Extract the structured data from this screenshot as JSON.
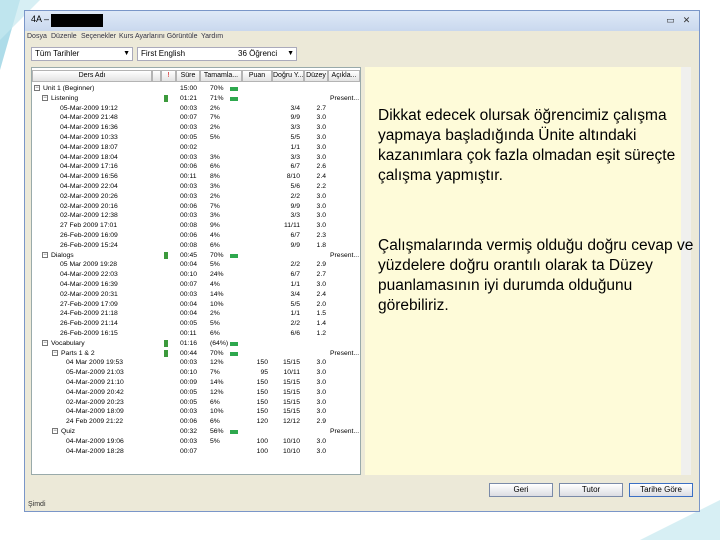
{
  "window": {
    "title": "4A –",
    "controls": [
      "▭",
      "✕"
    ]
  },
  "menu": [
    "Dosya",
    "Düzenle",
    "Seçenekler",
    "Kurs Ayarlarını Görüntüle",
    "Yardım"
  ],
  "filters": {
    "group": "Tüm Tarihler",
    "course": "First English",
    "count": "36 Öğrenci"
  },
  "columns": [
    "Ders Adı",
    "",
    "",
    "Süre",
    "Tamamla...",
    "Puan",
    "Doğru Y...",
    "Düzey",
    "Açıkla..."
  ],
  "rows": [
    {
      "lvl": 0,
      "toggle": "−",
      "name": "Unit 1 (Beginner)",
      "flag": false,
      "time": "15:00",
      "pct": "70%",
      "bar": true,
      "score": "",
      "correct": "",
      "level": "",
      "note": ""
    },
    {
      "lvl": 1,
      "toggle": "−",
      "name": "Listening",
      "flag": true,
      "time": "01:21",
      "pct": "71%",
      "bar": true,
      "score": "",
      "correct": "",
      "level": "",
      "note": "Present..."
    },
    {
      "lvl": 2,
      "name": "05-Mar-2009 19:12",
      "time": "00:03",
      "pct": "2%",
      "score": "",
      "correct": "3/4",
      "level": "2.7",
      "note": ""
    },
    {
      "lvl": 2,
      "name": "04-Mar-2009 21:48",
      "time": "00:07",
      "pct": "7%",
      "score": "",
      "correct": "9/9",
      "level": "3.0",
      "note": ""
    },
    {
      "lvl": 2,
      "name": "04-Mar-2009 16:36",
      "time": "00:03",
      "pct": "2%",
      "score": "",
      "correct": "3/3",
      "level": "3.0",
      "note": ""
    },
    {
      "lvl": 2,
      "name": "04-Mar-2009 10:33",
      "time": "00:05",
      "pct": "5%",
      "score": "",
      "correct": "5/5",
      "level": "3.0",
      "note": ""
    },
    {
      "lvl": 2,
      "name": "04-Mar-2009 18:07",
      "time": "00:02",
      "pct": "",
      "score": "",
      "correct": "1/1",
      "level": "3.0",
      "note": ""
    },
    {
      "lvl": 2,
      "name": "04-Mar-2009 18:04",
      "time": "00:03",
      "pct": "3%",
      "score": "",
      "correct": "3/3",
      "level": "3.0",
      "note": ""
    },
    {
      "lvl": 2,
      "name": "04-Mar-2009 17:16",
      "time": "00:06",
      "pct": "6%",
      "score": "",
      "correct": "6/7",
      "level": "2.6",
      "note": ""
    },
    {
      "lvl": 2,
      "name": "04-Mar-2009 16:56",
      "time": "00:11",
      "pct": "8%",
      "score": "",
      "correct": "8/10",
      "level": "2.4",
      "note": ""
    },
    {
      "lvl": 2,
      "name": "04-Mar-2009 22:04",
      "time": "00:03",
      "pct": "3%",
      "score": "",
      "correct": "5/6",
      "level": "2.2",
      "note": ""
    },
    {
      "lvl": 2,
      "name": "02-Mar-2009 20:26",
      "time": "00:03",
      "pct": "2%",
      "score": "",
      "correct": "2/2",
      "level": "3.0",
      "note": ""
    },
    {
      "lvl": 2,
      "name": "02-Mar-2009 20:16",
      "time": "00:06",
      "pct": "7%",
      "score": "",
      "correct": "9/9",
      "level": "3.0",
      "note": ""
    },
    {
      "lvl": 2,
      "name": "02-Mar-2009 12:38",
      "time": "00:03",
      "pct": "3%",
      "score": "",
      "correct": "3/3",
      "level": "3.0",
      "note": ""
    },
    {
      "lvl": 2,
      "name": "27 Feb 2009 17:01",
      "time": "00:08",
      "pct": "9%",
      "score": "",
      "correct": "11/11",
      "level": "3.0",
      "note": ""
    },
    {
      "lvl": 2,
      "name": "26-Feb-2009 16:09",
      "time": "00:06",
      "pct": "4%",
      "score": "",
      "correct": "6/7",
      "level": "2.3",
      "note": ""
    },
    {
      "lvl": 2,
      "name": "26-Feb-2009 15:24",
      "time": "00:08",
      "pct": "6%",
      "score": "",
      "correct": "9/9",
      "level": "1.8",
      "note": ""
    },
    {
      "lvl": 1,
      "toggle": "−",
      "name": "Dialogs",
      "flag": true,
      "time": "00:45",
      "pct": "70%",
      "bar": true,
      "score": "",
      "correct": "",
      "level": "",
      "note": "Present..."
    },
    {
      "lvl": 2,
      "name": "05 Mar 2009 19:28",
      "time": "00:04",
      "pct": "5%",
      "score": "",
      "correct": "2/2",
      "level": "2.9",
      "note": ""
    },
    {
      "lvl": 2,
      "name": "04-Mar-2009 22:03",
      "time": "00:10",
      "pct": "24%",
      "score": "",
      "correct": "6/7",
      "level": "2.7",
      "note": ""
    },
    {
      "lvl": 2,
      "name": "04-Mar-2009 16:39",
      "time": "00:07",
      "pct": "4%",
      "score": "",
      "correct": "1/1",
      "level": "3.0",
      "note": ""
    },
    {
      "lvl": 2,
      "name": "02-Mar-2009 20:31",
      "time": "00:03",
      "pct": "14%",
      "score": "",
      "correct": "3/4",
      "level": "2.4",
      "note": ""
    },
    {
      "lvl": 2,
      "name": "27-Feb-2009 17:09",
      "time": "00:04",
      "pct": "10%",
      "score": "",
      "correct": "5/5",
      "level": "2.0",
      "note": ""
    },
    {
      "lvl": 2,
      "name": "24-Feb-2009 21:18",
      "time": "00:04",
      "pct": "2%",
      "score": "",
      "correct": "1/1",
      "level": "1.5",
      "note": ""
    },
    {
      "lvl": 2,
      "name": "26-Feb-2009 21:14",
      "time": "00:05",
      "pct": "5%",
      "score": "",
      "correct": "2/2",
      "level": "1.4",
      "note": ""
    },
    {
      "lvl": 2,
      "name": "26-Feb-2009 16:15",
      "time": "00:11",
      "pct": "6%",
      "score": "",
      "correct": "6/6",
      "level": "1.2",
      "note": ""
    },
    {
      "lvl": 1,
      "toggle": "−",
      "name": "Vocabulary",
      "flag": true,
      "time": "01:16",
      "pct": "(64%)",
      "bar": true,
      "score": "",
      "correct": "",
      "level": "",
      "note": ""
    },
    {
      "lvl": 2,
      "toggle": "−",
      "name": "Parts 1 & 2",
      "flag": true,
      "time": "00:44",
      "pct": "70%",
      "bar": true,
      "score": "",
      "correct": "",
      "level": "",
      "note": "Present..."
    },
    {
      "lvl": 3,
      "name": "04 Mar 2009 19:53",
      "time": "00:03",
      "pct": "12%",
      "score": "150",
      "correct": "15/15",
      "level": "3.0",
      "note": ""
    },
    {
      "lvl": 3,
      "name": "05-Mar-2009 21:03",
      "time": "00:10",
      "pct": "7%",
      "score": "95",
      "correct": "10/11",
      "level": "3.0",
      "note": ""
    },
    {
      "lvl": 3,
      "name": "04-Mar-2009 21:10",
      "time": "00:09",
      "pct": "14%",
      "score": "150",
      "correct": "15/15",
      "level": "3.0",
      "note": ""
    },
    {
      "lvl": 3,
      "name": "04-Mar-2009 20:42",
      "time": "00:05",
      "pct": "12%",
      "score": "150",
      "correct": "15/15",
      "level": "3.0",
      "note": ""
    },
    {
      "lvl": 3,
      "name": "02-Mar-2009 20:23",
      "time": "00:05",
      "pct": "6%",
      "score": "150",
      "correct": "15/15",
      "level": "3.0",
      "note": ""
    },
    {
      "lvl": 3,
      "name": "04-Mar-2009 18:09",
      "time": "00:03",
      "pct": "10%",
      "score": "150",
      "correct": "15/15",
      "level": "3.0",
      "note": ""
    },
    {
      "lvl": 3,
      "name": "24 Feb 2009 21:22",
      "time": "00:06",
      "pct": "6%",
      "score": "120",
      "correct": "12/12",
      "level": "2.9",
      "note": ""
    },
    {
      "lvl": 2,
      "toggle": "−",
      "name": "Quiz",
      "flag": false,
      "time": "00:32",
      "pct": "56%",
      "bar": true,
      "score": "",
      "correct": "",
      "level": "",
      "note": "Present..."
    },
    {
      "lvl": 3,
      "name": "04-Mar-2009 19:06",
      "time": "00:03",
      "pct": "5%",
      "score": "100",
      "correct": "10/10",
      "level": "3.0",
      "note": ""
    },
    {
      "lvl": 3,
      "name": "04-Mar-2009 18:28",
      "time": "00:07",
      "pct": "",
      "score": "100",
      "correct": "10/10",
      "level": "3.0",
      "note": ""
    }
  ],
  "notes": [
    "Dikkat edecek olursak öğrencimiz çalışma yapmaya başladığında Ünite altındaki kazanımlara çok fazla olmadan eşit süreçte çalışma yapmıştır.",
    "Çalışmalarında vermiş olduğu doğru cevap ve yüzdelere doğru orantılı olarak ta Düzey puanlamasının iyi durumda olduğunu görebiliriz."
  ],
  "buttons": {
    "back": "Geri",
    "tutor": "Tutor",
    "date": "Tarihe Göre"
  },
  "status": "Şimdi",
  "colors": {
    "accent": "#2ea84e",
    "notes_bg": "#fefbd9",
    "frame": "#7a96c8",
    "deco": "#9ad3e4"
  }
}
